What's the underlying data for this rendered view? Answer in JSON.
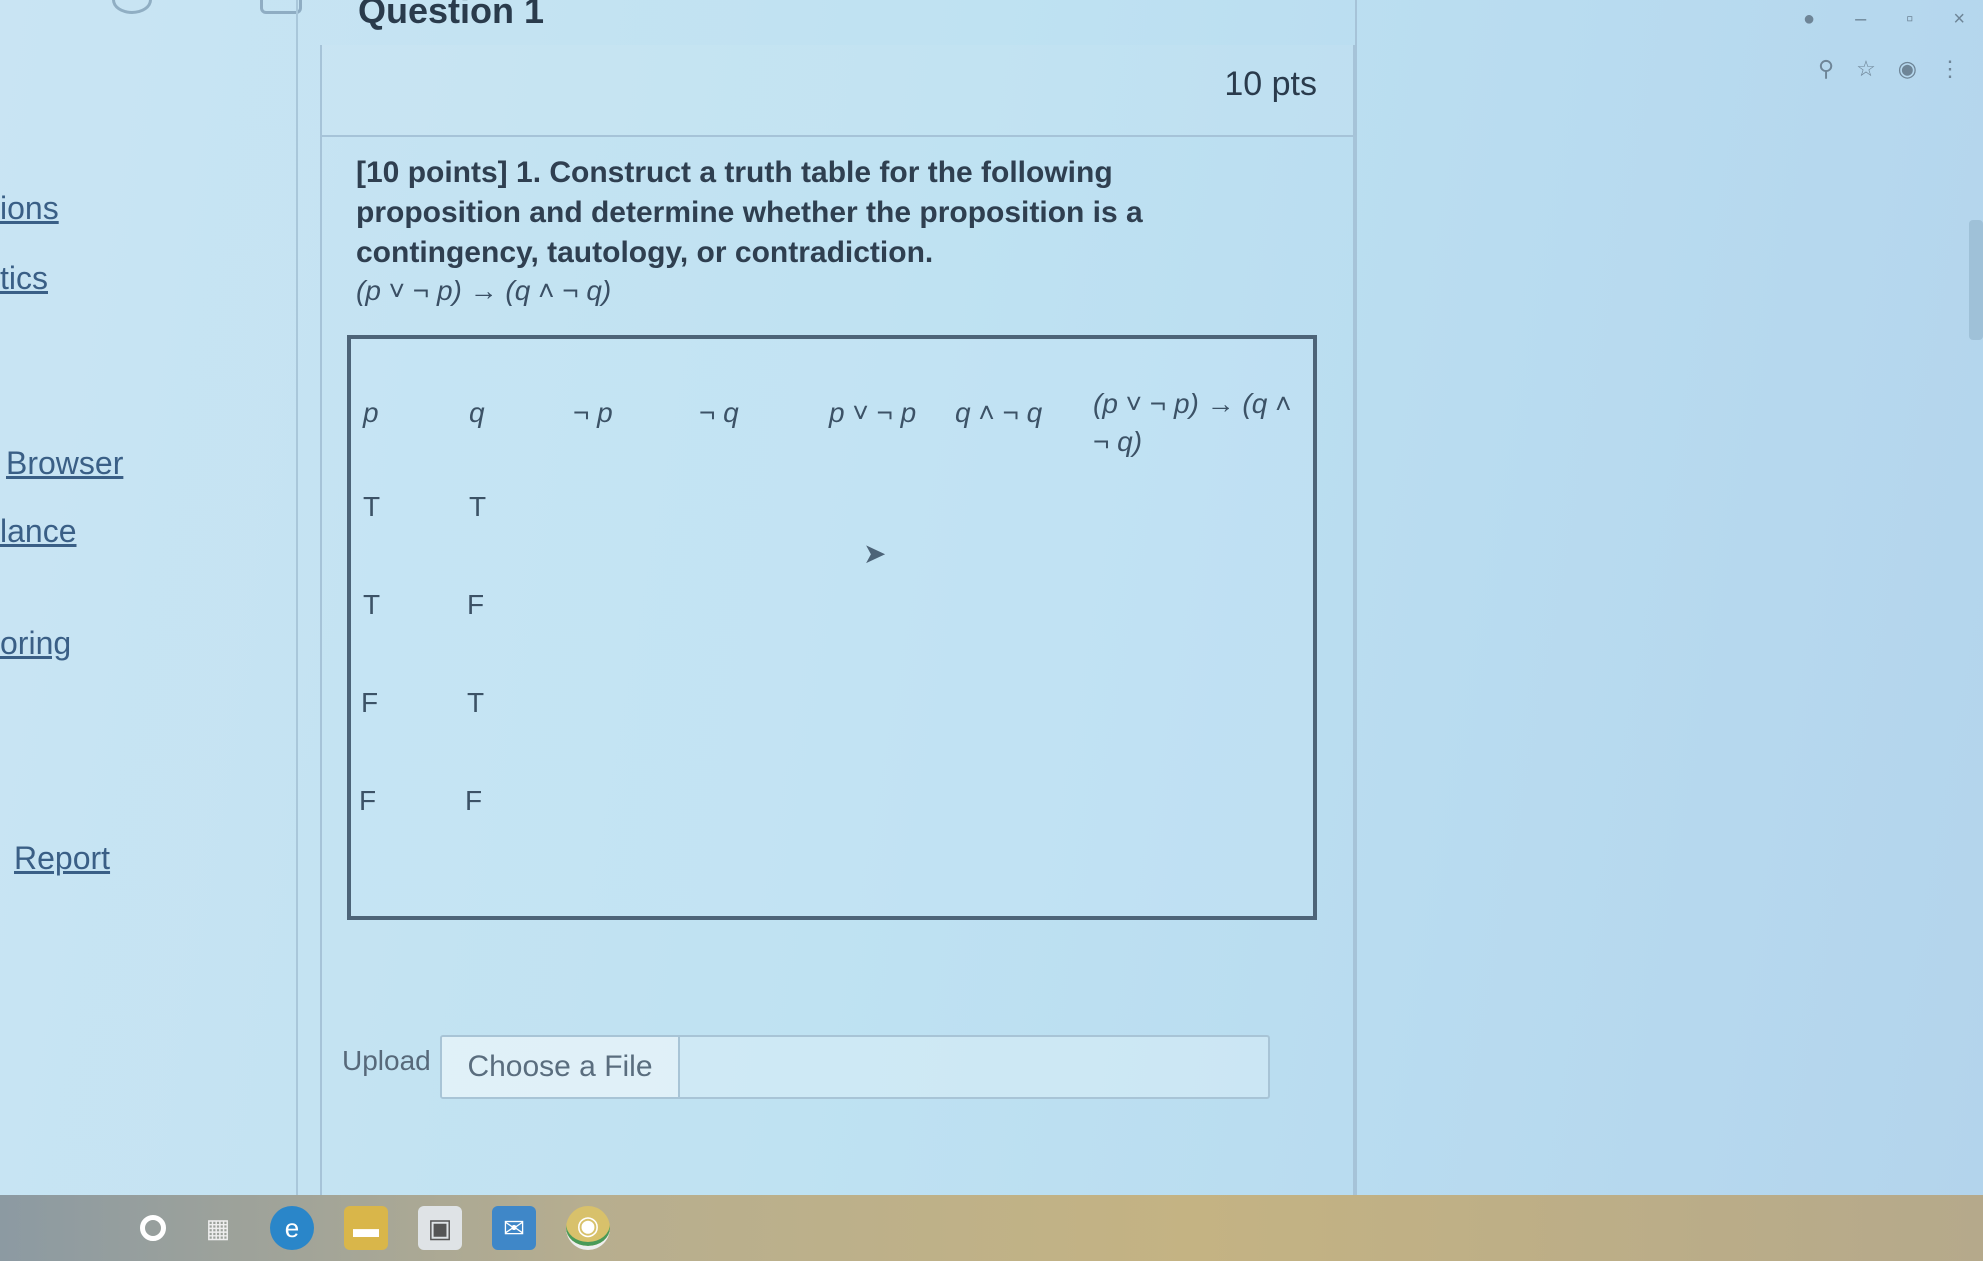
{
  "nav": {
    "items": [
      "ions",
      "tics",
      "Browser",
      "lance",
      "oring",
      "Report"
    ]
  },
  "question": {
    "title": "Question 1",
    "points": "10 pts",
    "text": "[10 points] 1. Construct a truth table for the following proposition and determine whether the proposition is a contingency, tautology, or contradiction.",
    "formula": "(p ˅ ¬ p) → (q ˄ ¬ q)"
  },
  "truth_table": {
    "headers": [
      "p",
      "q",
      "¬ p",
      "¬ q",
      "p ˅ ¬ p",
      "q ˄ ¬ q",
      "(p ˅ ¬ p) → (q ˄ ¬ q)"
    ],
    "rows": [
      [
        "T",
        "T"
      ],
      [
        "T",
        "F"
      ],
      [
        "F",
        "T"
      ],
      [
        "F",
        "F"
      ]
    ]
  },
  "upload": {
    "label": "Upload",
    "button": "Choose a File"
  },
  "window": {
    "controls": [
      "●",
      "–",
      "▫",
      "×"
    ]
  },
  "browser_tools": [
    "⚲",
    "☆",
    "◉",
    "⋮"
  ]
}
